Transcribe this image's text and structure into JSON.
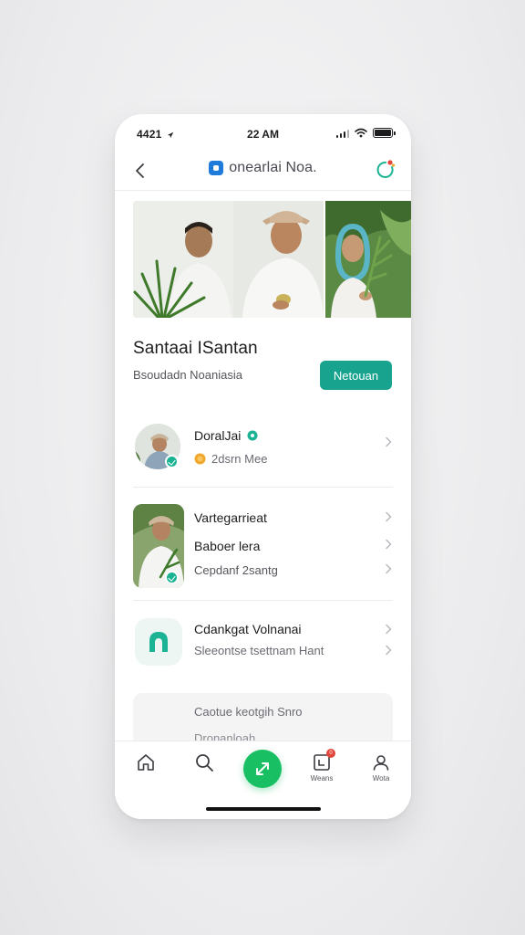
{
  "status_bar": {
    "time_left": "4421",
    "time_center": "22 AM"
  },
  "nav": {
    "title": "onearlai Noa.",
    "back_icon": "chevron-left-icon",
    "action_icon": "refresh-icon"
  },
  "profile": {
    "name": "Santaai ISantan",
    "subtitle": "Bsoudadn Noaniasia",
    "follow_label": "Netouan"
  },
  "list": [
    {
      "title": "DoralJai",
      "meta": "2dsrn Mee"
    },
    {
      "title": "Vartegarrieat",
      "line2": "Baboer lera",
      "line3": "Cepdanf 2santg"
    },
    {
      "title": "Cdankgat Volnanai",
      "subtitle": "Sleeontse tsettnam Hant"
    }
  ],
  "card": {
    "line1": "Caotue keotgih Snro",
    "line2": "Dronanloah"
  },
  "tabs": [
    {
      "icon": "home-icon",
      "label": ""
    },
    {
      "icon": "search-icon",
      "label": ""
    },
    {
      "icon": "compose-icon",
      "label": ""
    },
    {
      "icon": "inbox-icon",
      "label": "Weans",
      "badge": "0"
    },
    {
      "icon": "profile-icon",
      "label": "Wota"
    }
  ],
  "colors": {
    "accent_teal": "#17a38e",
    "fab_green": "#18bf63",
    "verified": "#1bb394",
    "logo_blue": "#1e7bd9"
  }
}
